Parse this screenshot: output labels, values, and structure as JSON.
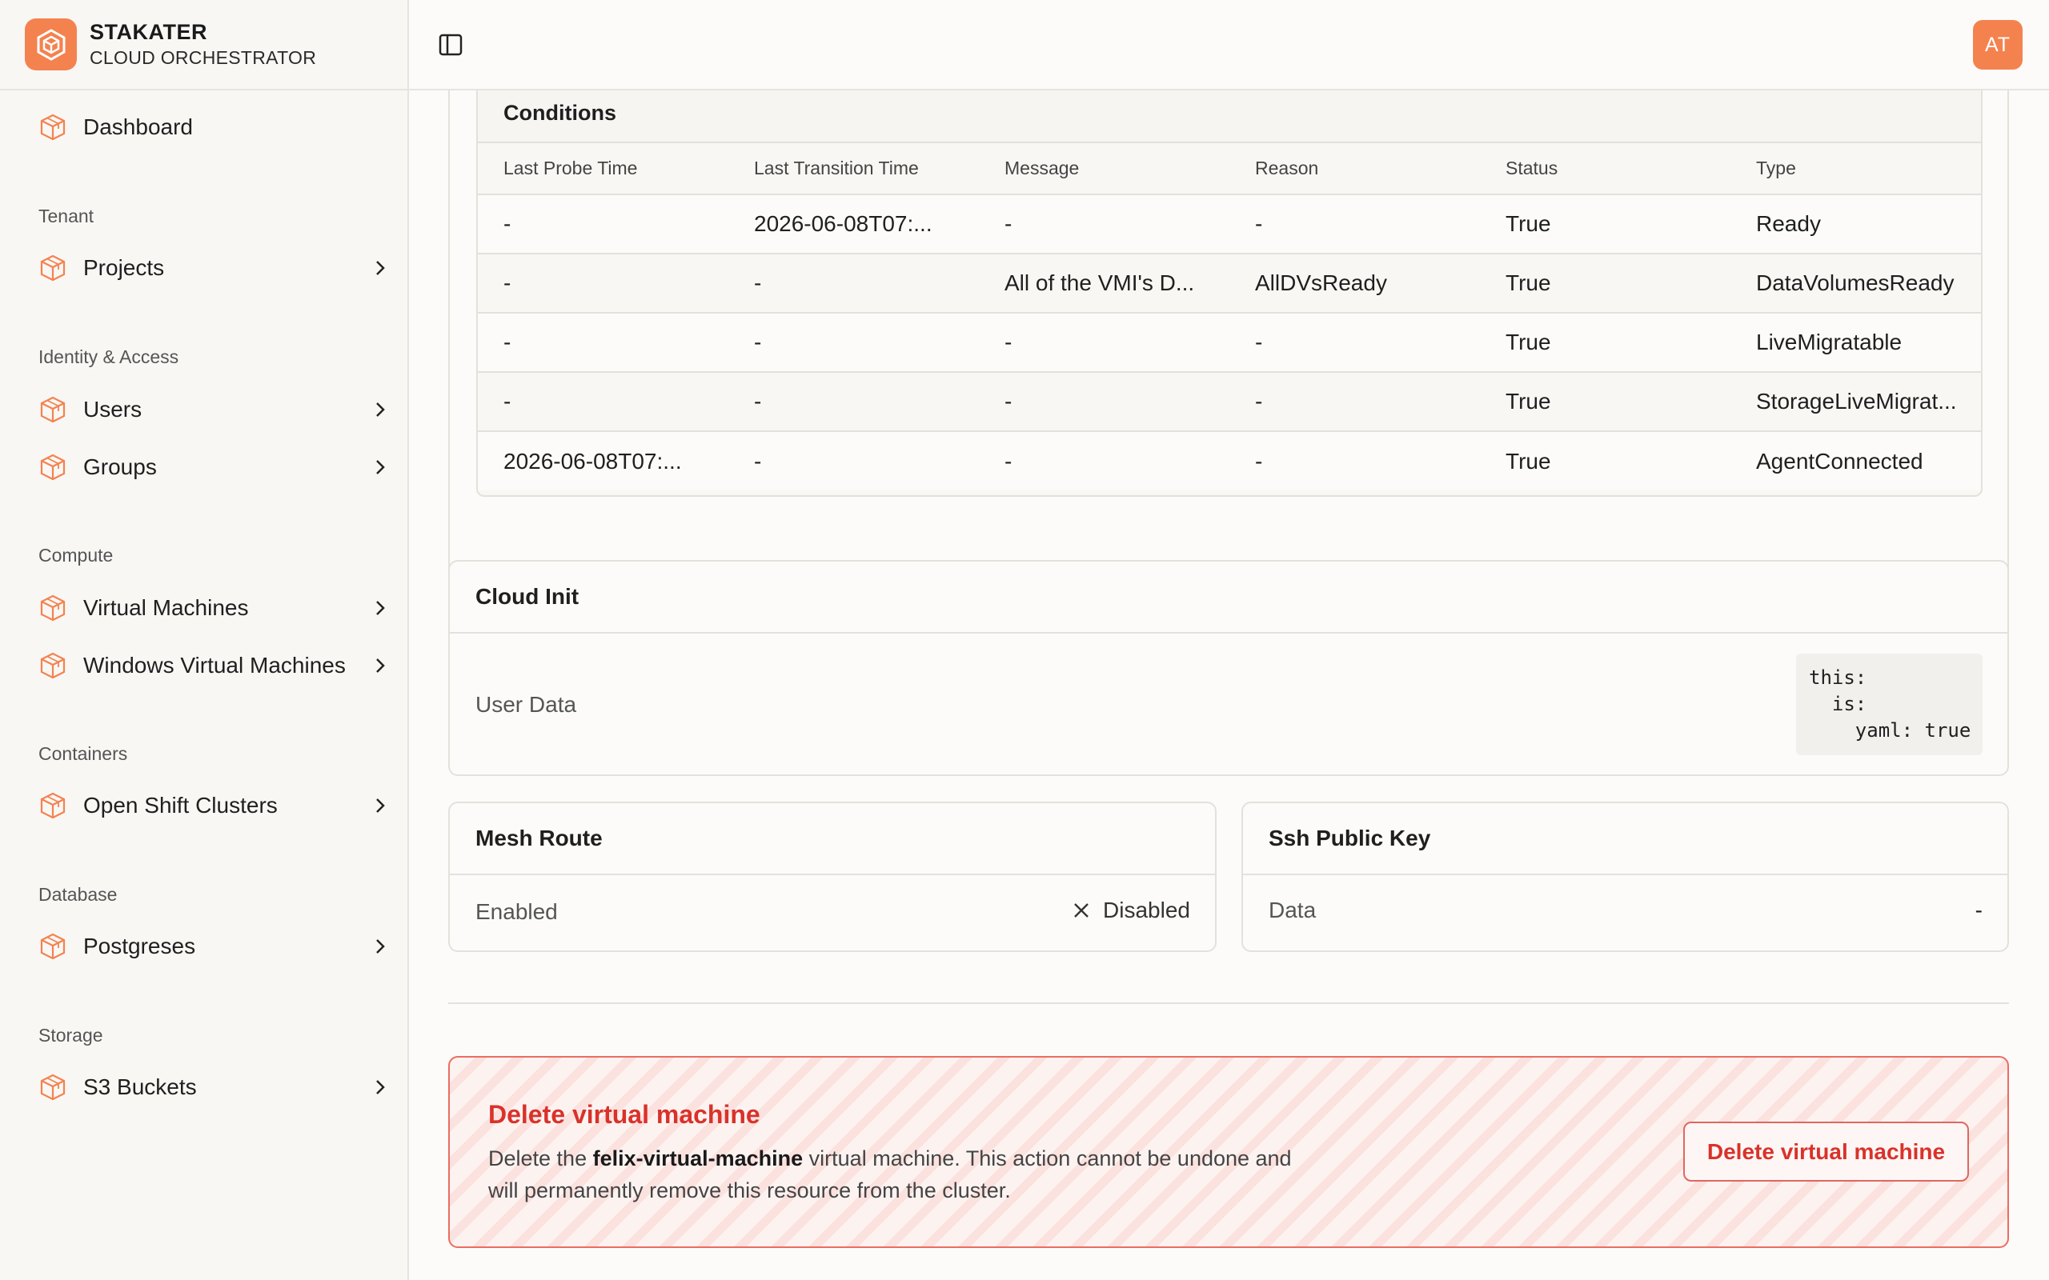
{
  "brand": {
    "name": "STAKATER",
    "subtitle": "CLOUD ORCHESTRATOR",
    "accent": "#f4824f"
  },
  "user": {
    "initials": "AT"
  },
  "sidebar": {
    "dashboard": "Dashboard",
    "sections": {
      "tenant": "Tenant",
      "identity": "Identity & Access",
      "compute": "Compute",
      "containers": "Containers",
      "database": "Database",
      "storage": "Storage"
    },
    "items": {
      "projects": "Projects",
      "users": "Users",
      "groups": "Groups",
      "vms": "Virtual Machines",
      "wvms": "Windows Virtual Machines",
      "openshift": "Open Shift Clusters",
      "postgres": "Postgreses",
      "s3": "S3 Buckets"
    }
  },
  "conditions": {
    "title": "Conditions",
    "columns": [
      "Last Probe Time",
      "Last Transition Time",
      "Message",
      "Reason",
      "Status",
      "Type"
    ],
    "rows": [
      [
        "-",
        "2026-06-08T07:...",
        "-",
        "-",
        "True",
        "Ready"
      ],
      [
        "-",
        "-",
        "All of the VMI's D...",
        "AllDVsReady",
        "True",
        "DataVolumesReady"
      ],
      [
        "-",
        "-",
        "-",
        "-",
        "True",
        "LiveMigratable"
      ],
      [
        "-",
        "-",
        "-",
        "-",
        "True",
        "StorageLiveMigrat..."
      ],
      [
        "2026-06-08T07:...",
        "-",
        "-",
        "-",
        "True",
        "AgentConnected"
      ]
    ]
  },
  "cloud_init": {
    "title": "Cloud Init",
    "label": "User Data",
    "code": "this:\n  is:\n    yaml: true"
  },
  "mesh_route": {
    "title": "Mesh Route",
    "label": "Enabled",
    "value": "Disabled"
  },
  "ssh_key": {
    "title": "Ssh Public Key",
    "label": "Data",
    "value": "-"
  },
  "danger": {
    "title": "Delete virtual machine",
    "desc_prefix": "Delete the ",
    "vm_name": "felix-virtual-machine",
    "desc_suffix": " virtual machine. This action cannot be undone and will permanently remove this resource from the cluster.",
    "button": "Delete virtual machine",
    "color": "#d9322a"
  }
}
